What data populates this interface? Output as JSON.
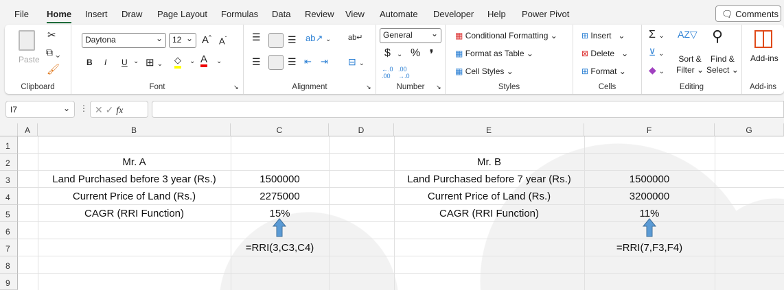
{
  "tabs": [
    "File",
    "Home",
    "Insert",
    "Draw",
    "Page Layout",
    "Formulas",
    "Data",
    "Review",
    "View",
    "Automate",
    "Developer",
    "Help",
    "Power Pivot"
  ],
  "comments_label": "Comments",
  "ribbon": {
    "clipboard": {
      "label": "Clipboard",
      "paste": "Paste"
    },
    "font": {
      "label": "Font",
      "name": "Daytona",
      "size": "12",
      "bold": "B",
      "italic": "I",
      "underline": "U"
    },
    "alignment": {
      "label": "Alignment"
    },
    "number": {
      "label": "Number",
      "format": "General",
      "currency": "$",
      "percent": "%",
      "comma": "❜"
    },
    "styles": {
      "label": "Styles",
      "conditional": "Conditional Formatting",
      "format_table": "Format as Table",
      "cell_styles": "Cell Styles"
    },
    "cells": {
      "label": "Cells",
      "insert": "Insert",
      "delete": "Delete",
      "format": "Format"
    },
    "editing": {
      "label": "Editing",
      "sort1": "Sort &",
      "sort2": "Filter",
      "find1": "Find &",
      "find2": "Select"
    },
    "addins": {
      "label": "Add-ins",
      "button": "Add-ins"
    }
  },
  "formula_bar": {
    "name_box": "I7",
    "fx": "fx",
    "value": ""
  },
  "columns": [
    "A",
    "B",
    "C",
    "D",
    "E",
    "F",
    "G"
  ],
  "rows": [
    "1",
    "2",
    "3",
    "4",
    "5",
    "6",
    "7",
    "8",
    "9"
  ],
  "cells": {
    "B2": "Mr. A",
    "B3": "Land Purchased before 3 year (Rs.)",
    "C3": "1500000",
    "B4": "Current Price of Land (Rs.)",
    "C4": "2275000",
    "B5": "CAGR (RRI Function)",
    "C5": "15%",
    "C7": "=RRI(3,C3,C4)",
    "E2": "Mr. B",
    "E3": "Land Purchased before 7 year (Rs.)",
    "F3": "1500000",
    "E4": "Current Price of Land (Rs.)",
    "F4": "3200000",
    "E5": "CAGR (RRI Function)",
    "F5": "11%",
    "F7": "=RRI(7,F3,F4)"
  },
  "colors": {
    "accent": "#1e6b3a",
    "arrow": "#5b9bd5"
  }
}
